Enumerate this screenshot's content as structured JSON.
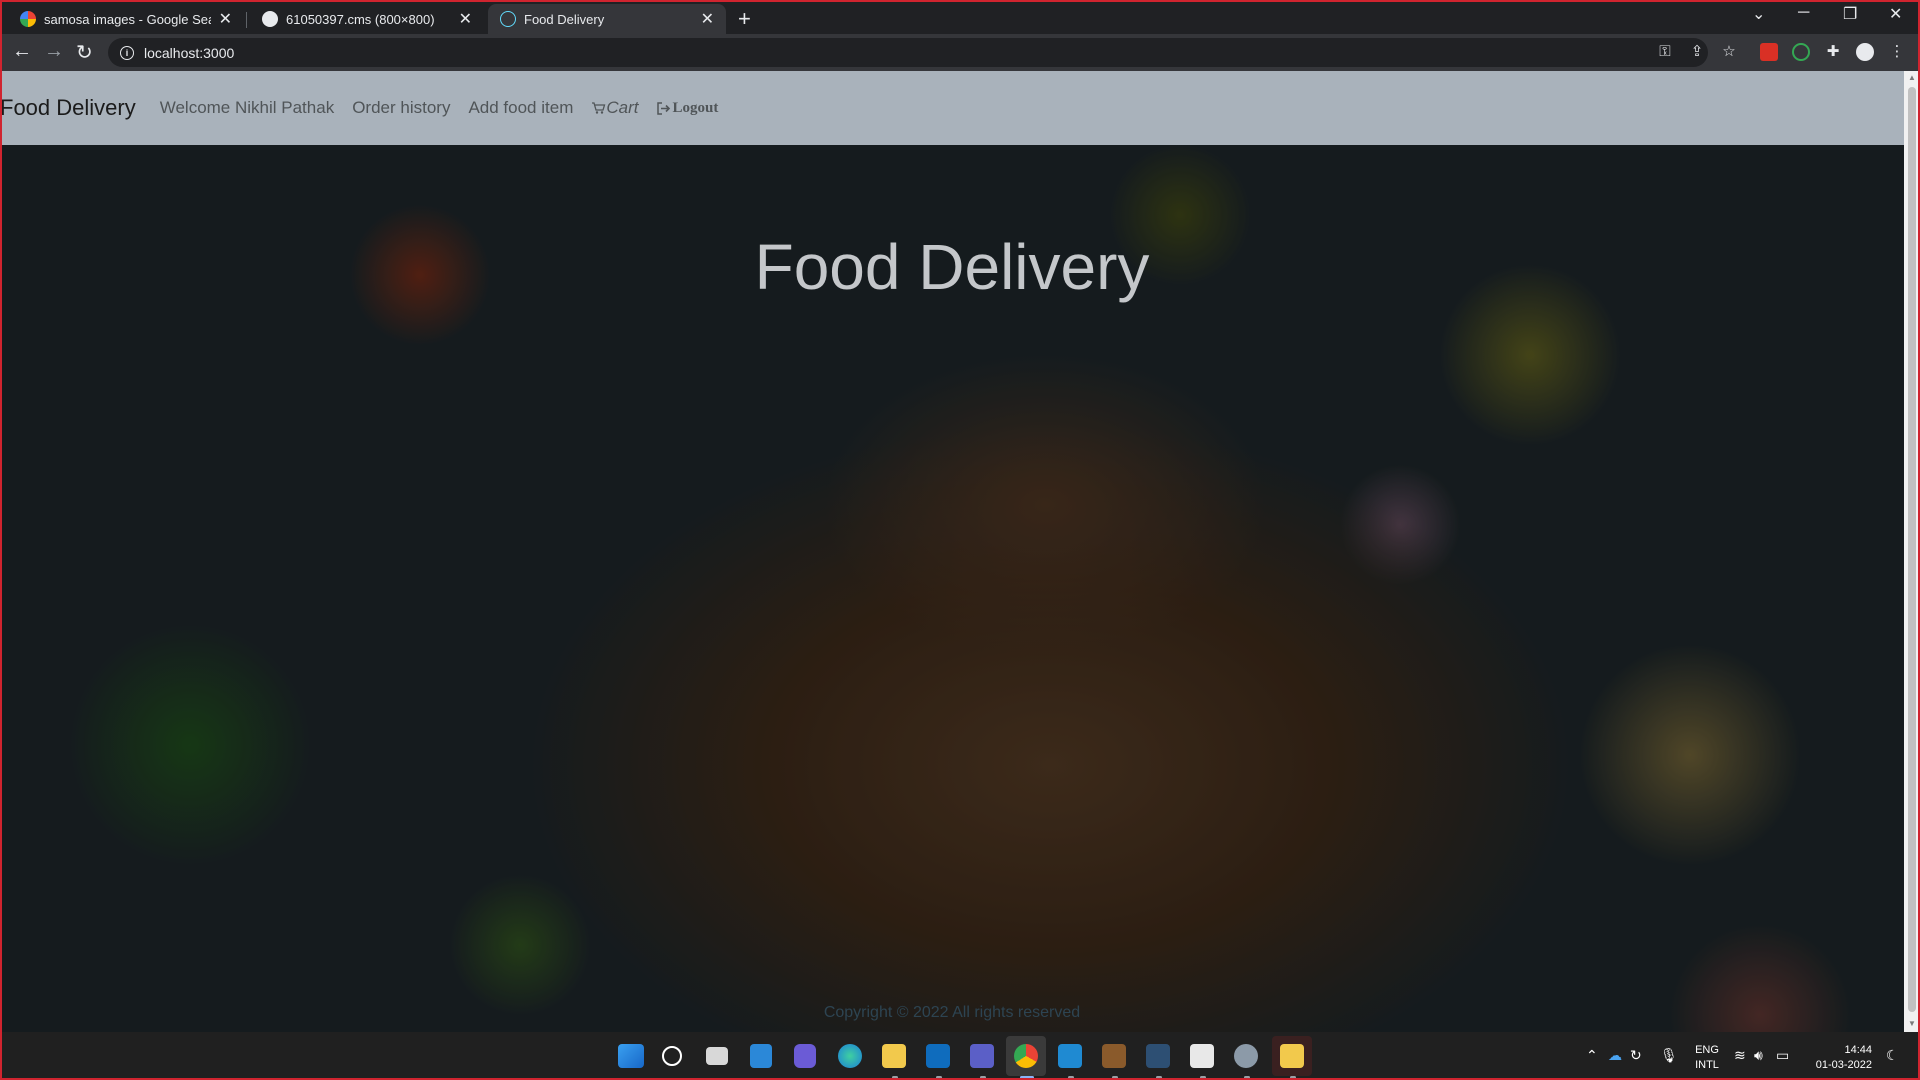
{
  "browser": {
    "tabs": [
      {
        "title": "samosa images - Google Search",
        "favicon": "google-icon",
        "active": false
      },
      {
        "title": "61050397.cms (800×800)",
        "favicon": "globe-icon",
        "active": false
      },
      {
        "title": "Food Delivery",
        "favicon": "react-icon",
        "active": true
      }
    ],
    "new_tab_label": "+",
    "url": "localhost:3000"
  },
  "navbar": {
    "brand": "Food Delivery",
    "welcome": "Welcome Nikhil Pathak",
    "order_history": "Order history",
    "add_food_item": "Add food item",
    "cart": "Cart",
    "logout": "Logout"
  },
  "hero": {
    "title": "Food Delivery"
  },
  "footer": {
    "copyright": "Copyright © 2022 All rights reserved"
  },
  "taskbar": {
    "language_top": "ENG",
    "language_bottom": "INTL",
    "time": "14:44",
    "date": "01-03-2022"
  },
  "colors": {
    "navbar_bg": "#a9b2bb",
    "browser_dark": "#202124",
    "hero_title": "#c4c7ca"
  }
}
